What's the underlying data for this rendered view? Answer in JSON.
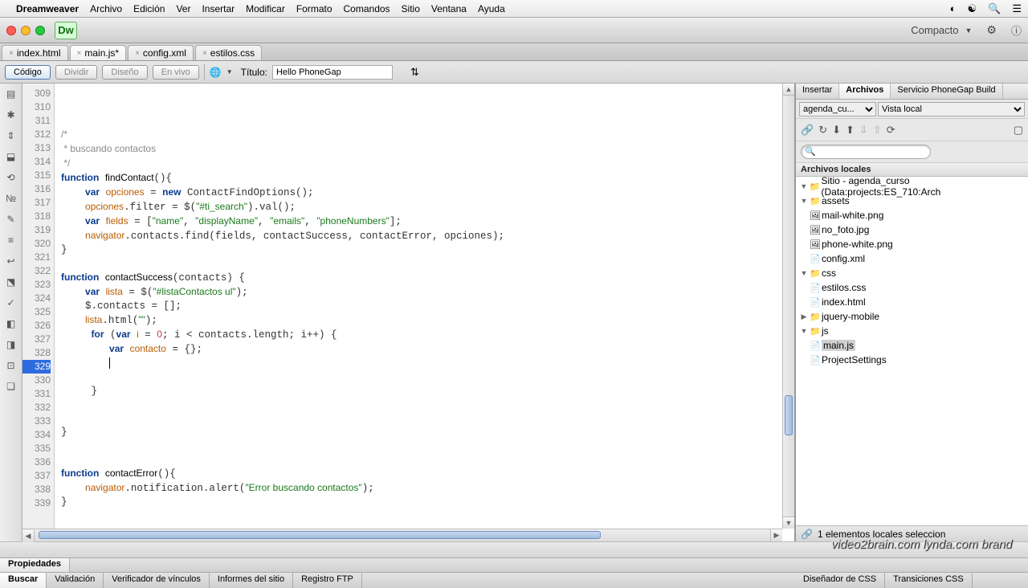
{
  "menubar": {
    "app": "Dreamweaver",
    "items": [
      "Archivo",
      "Edición",
      "Ver",
      "Insertar",
      "Modificar",
      "Formato",
      "Comandos",
      "Sitio",
      "Ventana",
      "Ayuda"
    ]
  },
  "apptoolbar": {
    "dw": "Dw",
    "compact": "Compacto"
  },
  "doctabs": [
    {
      "label": "index.html",
      "dirty": false,
      "active": false
    },
    {
      "label": "main.js*",
      "dirty": true,
      "active": true
    },
    {
      "label": "config.xml",
      "dirty": false,
      "active": false
    },
    {
      "label": "estilos.css",
      "dirty": false,
      "active": false
    }
  ],
  "viewbar": {
    "code": "Código",
    "split": "Dividir",
    "design": "Diseño",
    "live": "En vivo",
    "title_label": "Título:",
    "title_value": "Hello PhoneGap"
  },
  "editor": {
    "first_line": 309,
    "highlighted_line": 329,
    "last_line": 339
  },
  "rpanel": {
    "tabs": {
      "insertar": "Insertar",
      "archivos": "Archivos",
      "phonegap": "Servicio PhoneGap Build"
    },
    "site_select": "agenda_cu...",
    "view_select": "Vista local",
    "local_header": "Archivos locales",
    "tree": {
      "root": "Sitio - agenda_curso (Data:projects:ES_710:Arch",
      "assets": "assets",
      "asset_items": [
        "mail-white.png",
        "no_foto.jpg",
        "phone-white.png"
      ],
      "config": "config.xml",
      "css": "css",
      "css_items": [
        "estilos.css"
      ],
      "index": "index.html",
      "jqm": "jquery-mobile",
      "js": "js",
      "js_items": [
        "main.js"
      ],
      "psettings": "ProjectSettings"
    },
    "footer": "1 elementos locales seleccion"
  },
  "propbar": {
    "label": "Propiedades"
  },
  "bottomtabs": [
    "Buscar",
    "Validación",
    "Verificador de vínculos",
    "Informes del sitio",
    "Registro FTP"
  ],
  "rbottomtabs": [
    "Diseñador de CSS",
    "Transiciones CSS"
  ],
  "watermark": "video2brain.com  lynda.com brand"
}
